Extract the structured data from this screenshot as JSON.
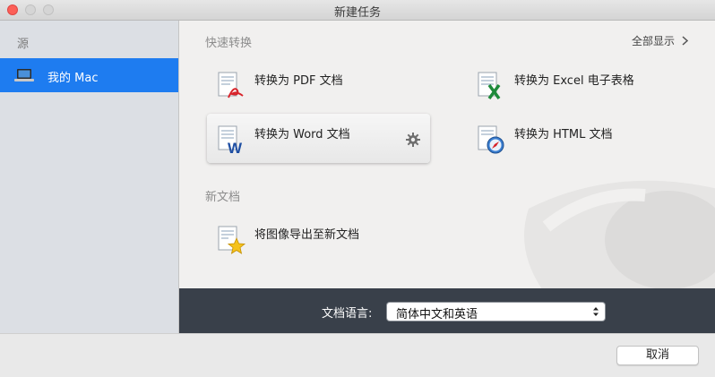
{
  "window": {
    "title": "新建任务"
  },
  "sidebar": {
    "header": "源",
    "items": [
      {
        "label": "我的 Mac",
        "icon": "laptop-icon",
        "selected": true
      }
    ]
  },
  "quick_convert": {
    "title": "快速转换",
    "show_all": "全部显示",
    "items": [
      {
        "label": "转换为 PDF 文档",
        "icon": "pdf-document-icon"
      },
      {
        "label": "转换为 Excel 电子表格",
        "icon": "excel-document-icon"
      },
      {
        "label": "转换为 Word 文档",
        "icon": "word-document-icon",
        "selected": true
      },
      {
        "label": "转换为 HTML 文档",
        "icon": "html-document-icon"
      }
    ]
  },
  "new_document": {
    "title": "新文档",
    "items": [
      {
        "label": "将图像导出至新文档",
        "icon": "export-image-icon"
      }
    ]
  },
  "language": {
    "label": "文档语言:",
    "value": "简体中文和英语"
  },
  "footer": {
    "cancel_label": "取消"
  },
  "colors": {
    "accent": "#1e7cf0",
    "langbar": "#39404a",
    "close": "#fc5f57"
  }
}
